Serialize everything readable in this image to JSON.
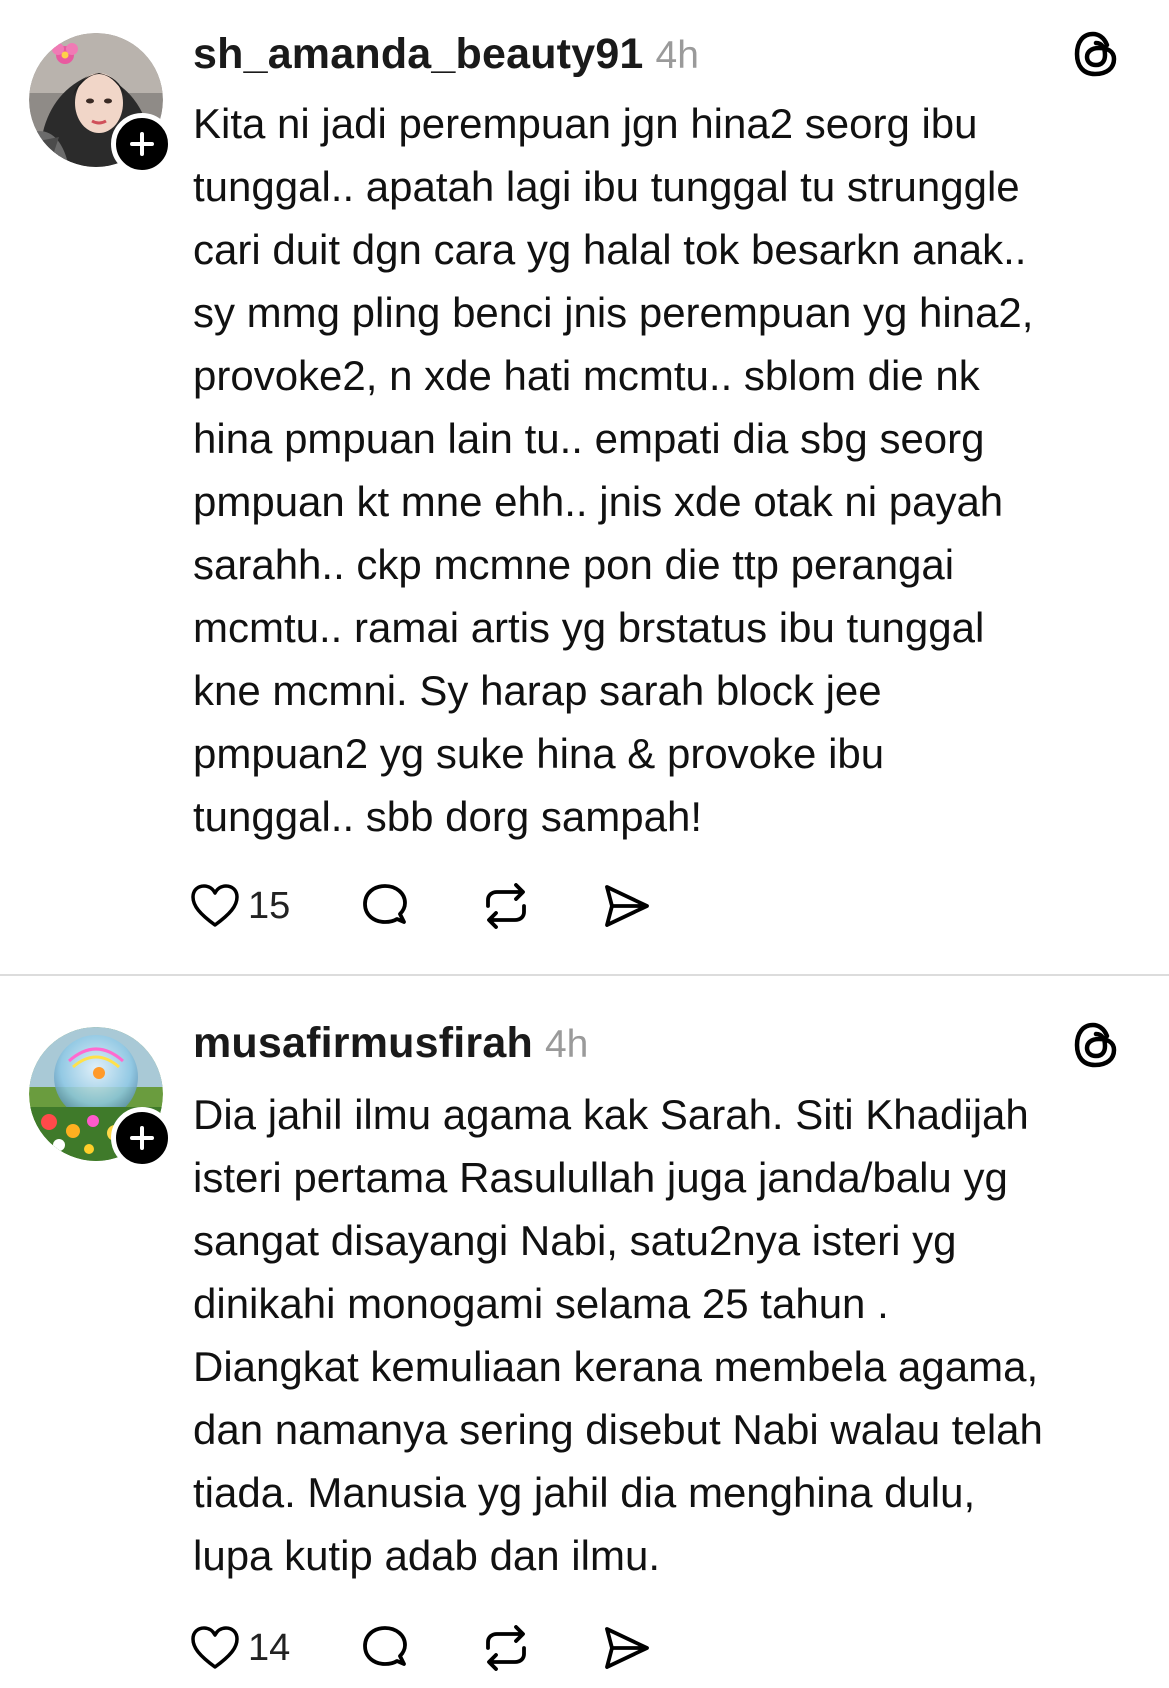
{
  "posts": [
    {
      "username": "sh_amanda_beauty91",
      "time": "4h",
      "body": "Kita ni jadi perempuan jgn hina2 seorg ibu\ntunggal.. apatah lagi ibu tunggal tu strunggle\ncari duit dgn cara yg halal tok besarkn anak..\nsy mmg pling benci jnis perempuan yg hina2,\nprovoke2, n xde hati mcmtu.. sblom die nk\nhina pmpuan lain tu.. empati dia sbg seorg\npmpuan kt mne ehh.. jnis xde otak ni payah\nsarahh.. ckp mcmne pon die ttp perangai\nmcmtu.. ramai artis yg brstatus ibu tunggal\nkne mcmni. Sy harap sarah block jee\npmpuan2 yg suke hina & provoke ibu\ntunggal.. sbb dorg sampah!",
      "likes": "15",
      "icons": {
        "avatar": "avatar-woman-hijab",
        "follow": "plus-icon",
        "brand": "threads-icon",
        "like": "heart-icon",
        "reply": "comment-icon",
        "repost": "repost-icon",
        "share": "send-icon"
      }
    },
    {
      "username": "musafirmusfirah",
      "time": "4h",
      "body": "Dia jahil ilmu agama kak Sarah. Siti Khadijah\nisteri pertama Rasulullah juga janda/balu yg\nsangat disayangi Nabi, satu2nya isteri yg\ndinikahi monogami selama 25 tahun .\nDiangkat kemuliaan kerana membela agama,\ndan namanya sering disebut Nabi walau telah\ntiada. Manusia yg jahil dia menghina dulu,\nlupa kutip adab dan ilmu.",
      "likes": "14",
      "icons": {
        "avatar": "avatar-flower-bubble",
        "follow": "plus-icon",
        "brand": "threads-icon",
        "like": "heart-icon",
        "reply": "comment-icon",
        "repost": "repost-icon",
        "share": "send-icon"
      }
    }
  ],
  "colors": {
    "text": "#111111",
    "meta": "#9a9a9a",
    "divider": "#dcdcdc",
    "badge": "#000000"
  }
}
